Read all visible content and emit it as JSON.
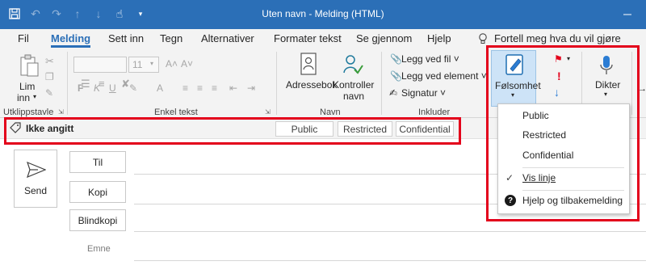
{
  "window": {
    "title": "Uten navn  -  Melding (HTML)"
  },
  "tabs": [
    "Fil",
    "Melding",
    "Sett inn",
    "Tegn",
    "Alternativer",
    "Formater tekst",
    "Se gjennom",
    "Hjelp"
  ],
  "active_tab": "Melding",
  "tell_me": "Fortell meg hva du vil gjøre",
  "ribbon": {
    "clipboard": {
      "label": "Utklippstavle",
      "paste_line1": "Lim",
      "paste_line2": "inn"
    },
    "basic_text": {
      "label": "Enkel tekst",
      "font_size": "11"
    },
    "names": {
      "label": "Navn",
      "addressbook": "Adressebok",
      "check_names_line1": "Kontroller",
      "check_names_line2": "navn"
    },
    "include": {
      "label": "Inkluder",
      "attach_file": "Legg ved fil",
      "attach_item": "Legg ved element",
      "signature": "Signatur"
    },
    "sensitivity": {
      "label": "Følsomhet"
    },
    "voice": {
      "label": "Dikter"
    }
  },
  "sensitivity_bar": {
    "status": "Ikke angitt",
    "options": [
      "Public",
      "Restricted",
      "Confidential"
    ]
  },
  "compose": {
    "send": "Send",
    "to": "Til",
    "cc": "Kopi",
    "bcc": "Blindkopi",
    "subject": "Emne"
  },
  "dropdown": {
    "items": [
      "Public",
      "Restricted",
      "Confidential"
    ],
    "show_bar": "Vis linje",
    "help": "Hjelp og tilbakemelding"
  },
  "colors": {
    "titlebar": "#2b6fb7",
    "accent": "#2b6fb7",
    "highlight": "#e3001b",
    "ribbon_bg": "#f3f3f3"
  }
}
